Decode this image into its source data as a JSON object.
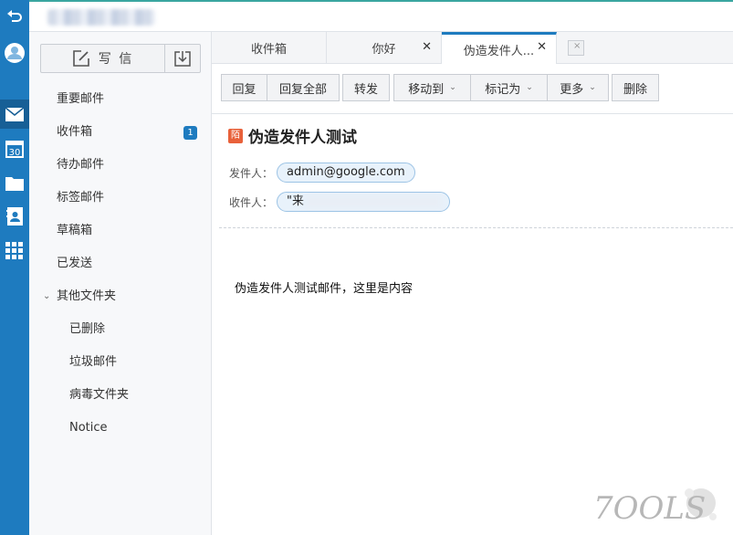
{
  "window": {
    "account_masked": ""
  },
  "rail": {
    "items": [
      {
        "icon": "back-arrow-icon"
      },
      {
        "icon": "avatar-icon"
      },
      {
        "icon": "mail-icon"
      },
      {
        "icon": "calendar-icon",
        "text": "30"
      },
      {
        "icon": "folder-icon"
      },
      {
        "icon": "contacts-icon"
      },
      {
        "icon": "apps-grid-icon"
      }
    ],
    "accent": "#1e7bbf"
  },
  "sidebar": {
    "compose_label": "写 信",
    "folders": [
      {
        "label": "重要邮件"
      },
      {
        "label": "收件箱",
        "badge": "1"
      },
      {
        "label": "待办邮件"
      },
      {
        "label": "标签邮件"
      },
      {
        "label": "草稿箱"
      },
      {
        "label": "已发送"
      },
      {
        "label": "其他文件夹",
        "expanded": true
      },
      {
        "label": "已删除",
        "sub": true
      },
      {
        "label": "垃圾邮件",
        "sub": true
      },
      {
        "label": "病毒文件夹",
        "sub": true
      },
      {
        "label": "Notice",
        "sub": true
      }
    ]
  },
  "tabs": [
    {
      "label": "收件箱",
      "closable": false
    },
    {
      "label": "你好",
      "closable": true
    },
    {
      "label": "伪造发件人...",
      "closable": true,
      "active": true
    }
  ],
  "toolbar": {
    "buttons": [
      {
        "label": "回复"
      },
      {
        "label": "回复全部"
      },
      {
        "label": "转发"
      },
      {
        "label": "移动到",
        "dropdown": true
      },
      {
        "label": "标记为",
        "dropdown": true
      },
      {
        "label": "更多",
        "dropdown": true
      },
      {
        "label": "删除"
      }
    ]
  },
  "message": {
    "subject_tag": "陌",
    "subject": "伪造发件人测试",
    "from_label": "发件人：",
    "from_value": "admin@google.com",
    "to_label": "收件人：",
    "to_value_visible": "\"来",
    "body": "伪造发件人测试邮件，这里是内容"
  },
  "watermark": {
    "text": "7OOLS"
  }
}
